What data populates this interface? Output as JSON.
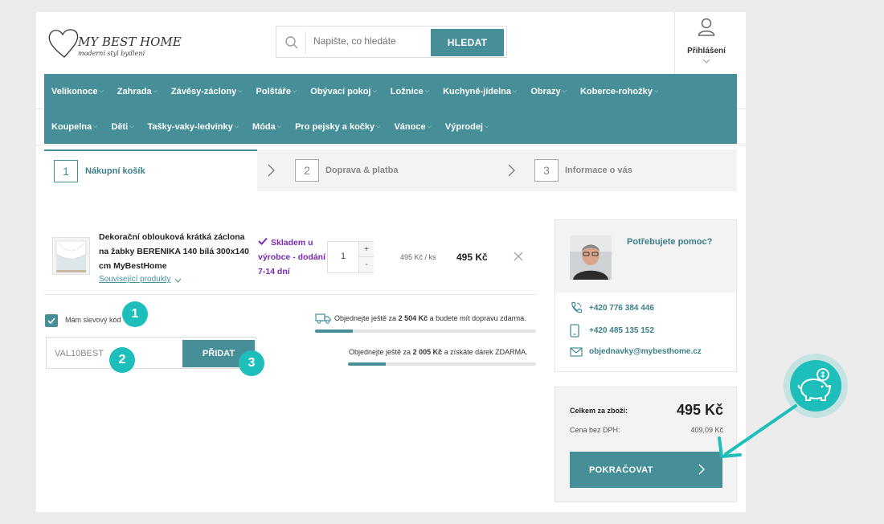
{
  "header": {
    "logo_main": "MY BEST HOME",
    "logo_sub": "moderní styl bydlení",
    "search_placeholder": "Napište, co hledáte",
    "search_button": "HLEDAT",
    "login_label": "Přihlášení"
  },
  "nav": {
    "row1": [
      "Velikonoce",
      "Zahrada",
      "Závěsy-záclony",
      "Polštáře",
      "Obývací pokoj",
      "Ložnice",
      "Kuchyně-jídelna",
      "Obrazy",
      "Koberce-rohožky"
    ],
    "row2": [
      "Koupelna",
      "Děti",
      "Tašky-vaky-ledvinky",
      "Móda",
      "Pro pejsky a kočky",
      "Vánoce",
      "Výprodej"
    ]
  },
  "steps": [
    {
      "num": "1",
      "label": "Nákupní košík"
    },
    {
      "num": "2",
      "label": "Doprava & platba"
    },
    {
      "num": "3",
      "label": "Informace o vás"
    }
  ],
  "cart": {
    "product_name": "Dekorační oblouková krátká záclona na žabky BERENIKA 140 bílá 300x140 cm MyBestHome",
    "related": "Související produkty",
    "stock": "Skladem u výrobce - dodání 7-14 dní",
    "qty": "1",
    "qty_plus": "+",
    "qty_minus": "-",
    "unit_price": "495 Kč / ks",
    "total_price": "495 Kč"
  },
  "coupon": {
    "label": "Mám slevový kód",
    "value": "VAL10BEST",
    "button": "PŘIDAT"
  },
  "badges": [
    "1",
    "2",
    "3"
  ],
  "shipping": {
    "text_pre": "Objednejte ještě za ",
    "amount": "2 504 Kč",
    "text_post": " a budete mít dopravu zdarma.",
    "progress": 0.17
  },
  "gift": {
    "text_pre": "Objednejte ještě za ",
    "amount": "2 005 Kč",
    "text_mid": " a získáte dárek ",
    "free": "ZDARMA",
    "text_end": ".",
    "progress": 0.2
  },
  "help": {
    "title": "Potřebujete pomoc?",
    "phone1": "+420 776 384 446",
    "phone2": "+420 485 135 152",
    "email": "objednavky@mybesthome.cz"
  },
  "summary": {
    "total_label": "Celkem za zboží:",
    "total_value": "495 Kč",
    "vat_label": "Cena bez DPH:",
    "vat_value": "409,09 Kč",
    "continue": "POKRAČOVAT"
  },
  "colors": {
    "accent": "#468f98",
    "badge": "#1ebfbb",
    "stock": "#7a28b4"
  }
}
